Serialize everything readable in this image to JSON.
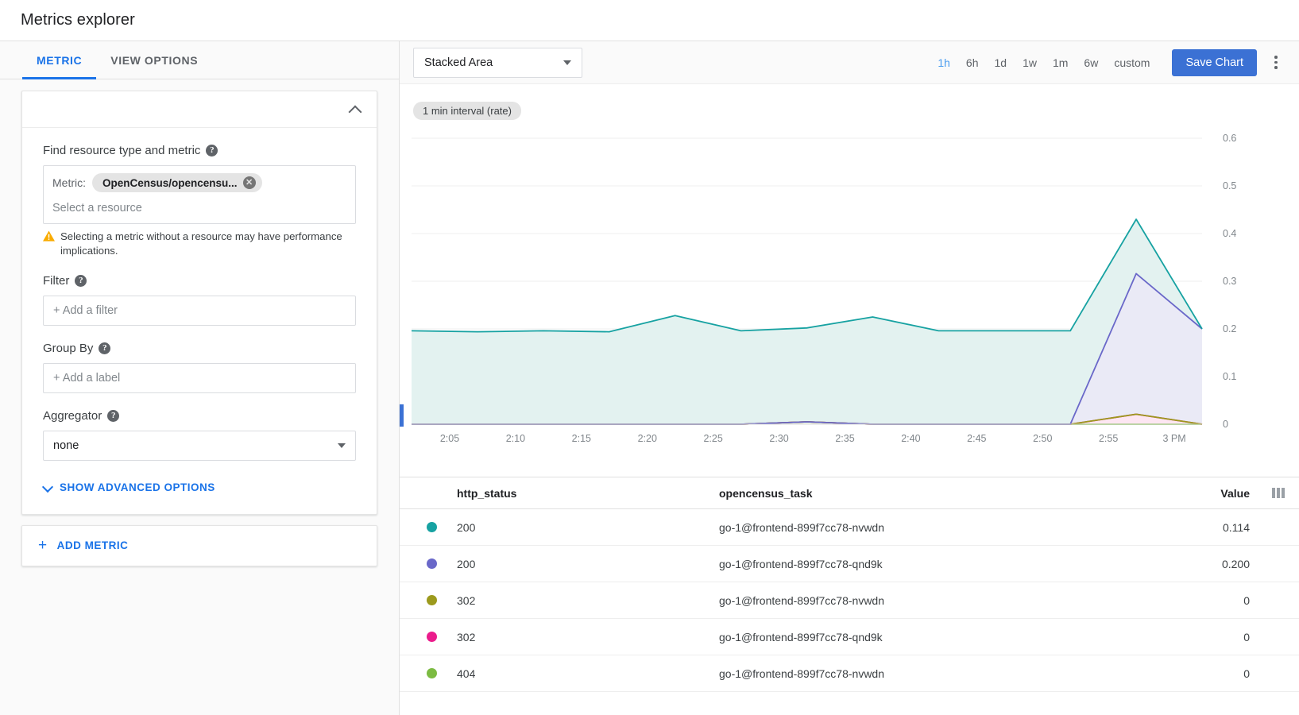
{
  "page": {
    "title": "Metrics explorer"
  },
  "left": {
    "tabs": [
      {
        "label": "METRIC",
        "active": true
      },
      {
        "label": "VIEW OPTIONS",
        "active": false
      }
    ],
    "find": {
      "label": "Find resource type and metric",
      "help": "?",
      "metric_key": "Metric:",
      "metric_chip": "OpenCensus/opencensu...",
      "chip_close": "✕",
      "resource_placeholder": "Select a resource",
      "warning": "Selecting a metric without a resource may have performance implications."
    },
    "filter": {
      "label": "Filter",
      "help": "?",
      "placeholder": "+ Add a filter"
    },
    "group_by": {
      "label": "Group By",
      "help": "?",
      "placeholder": "+ Add a label"
    },
    "aggregator": {
      "label": "Aggregator",
      "help": "?",
      "value": "none"
    },
    "advanced_label": "SHOW ADVANCED OPTIONS",
    "add_metric_label": "ADD METRIC",
    "add_metric_plus": "+"
  },
  "toolbar": {
    "chart_type": "Stacked Area",
    "ranges": [
      {
        "label": "1h",
        "active": true
      },
      {
        "label": "6h",
        "active": false
      },
      {
        "label": "1d",
        "active": false
      },
      {
        "label": "1w",
        "active": false
      },
      {
        "label": "1m",
        "active": false
      },
      {
        "label": "6w",
        "active": false
      },
      {
        "label": "custom",
        "active": false
      }
    ],
    "save_label": "Save Chart"
  },
  "chart": {
    "interval_pill": "1 min interval (rate)"
  },
  "chart_data": {
    "type": "area",
    "title": "",
    "subtitle": "1 min interval (rate)",
    "stacked": true,
    "xlabel": "",
    "ylabel": "",
    "ylim": [
      0,
      0.6
    ],
    "yticks": [
      "0",
      "0.1",
      "0.2",
      "0.3",
      "0.4",
      "0.5",
      "0.6"
    ],
    "ytick_values": [
      0,
      0.1,
      0.2,
      0.3,
      0.4,
      0.5,
      0.6
    ],
    "xticks": [
      "2:05",
      "2:10",
      "2:15",
      "2:20",
      "2:25",
      "2:30",
      "2:35",
      "2:40",
      "2:45",
      "2:50",
      "2:55",
      "3 PM"
    ],
    "grid": true,
    "legend_position": "table-below",
    "x": [
      2.0,
      2.05,
      2.1,
      2.15,
      2.2,
      2.25,
      2.3,
      2.35,
      2.4,
      2.45,
      2.5,
      2.55,
      3.0
    ],
    "series": [
      {
        "name": "200 go-1@frontend-899f7cc78-nvwdn",
        "color": "#17a2a2",
        "fill": "#e3f2f0",
        "http_status": "200",
        "task": "go-1@frontend-899f7cc78-nvwdn",
        "value": "0.114",
        "values": [
          0.196,
          0.194,
          0.196,
          0.194,
          0.228,
          0.196,
          0.197,
          0.225,
          0.196,
          0.196,
          0.196,
          0.114,
          0.0
        ]
      },
      {
        "name": "200 go-1@frontend-899f7cc78-qnd9k",
        "color": "#6a68c9",
        "fill": "#eaeaf6",
        "http_status": "200",
        "task": "go-1@frontend-899f7cc78-qnd9k",
        "value": "0.200",
        "values": [
          0.0,
          0.0,
          0.0,
          0.0,
          0.0,
          0.0,
          0.0,
          0.0,
          0.0,
          0.0,
          0.0,
          0.295,
          0.2
        ]
      },
      {
        "name": "302 go-1@frontend-899f7cc78-nvwdn",
        "color": "#9c9a1d",
        "fill": "#f5f3d8",
        "http_status": "302",
        "task": "go-1@frontend-899f7cc78-nvwdn",
        "value": "0",
        "values": [
          0,
          0,
          0,
          0,
          0,
          0,
          0,
          0,
          0,
          0,
          0,
          0,
          0
        ]
      },
      {
        "name": "302 go-1@frontend-899f7cc78-qnd9k",
        "color": "#eb1c8c",
        "fill": "#fde6f2",
        "http_status": "302",
        "task": "go-1@frontend-899f7cc78-qnd9k",
        "value": "0",
        "values": [
          0,
          0,
          0,
          0,
          0,
          0,
          0,
          0,
          0,
          0,
          0,
          0.021,
          0
        ]
      },
      {
        "name": "404 go-1@frontend-899f7cc78-nvwdn",
        "color": "#7cbb42",
        "fill": "#edf6e3",
        "http_status": "404",
        "task": "go-1@frontend-899f7cc78-nvwdn",
        "value": "0",
        "values": [
          0,
          0,
          0,
          0,
          0,
          0,
          0.005,
          0,
          0,
          0,
          0,
          0,
          0
        ]
      }
    ]
  },
  "table": {
    "columns": {
      "status": "http_status",
      "task": "opencensus_task",
      "value": "Value"
    },
    "rows": [
      {
        "color": "#17a2a2",
        "status": "200",
        "task": "go-1@frontend-899f7cc78-nvwdn",
        "value": "0.114"
      },
      {
        "color": "#6a68c9",
        "status": "200",
        "task": "go-1@frontend-899f7cc78-qnd9k",
        "value": "0.200"
      },
      {
        "color": "#9c9a1d",
        "status": "302",
        "task": "go-1@frontend-899f7cc78-nvwdn",
        "value": "0"
      },
      {
        "color": "#eb1c8c",
        "status": "302",
        "task": "go-1@frontend-899f7cc78-qnd9k",
        "value": "0"
      },
      {
        "color": "#7cbb42",
        "status": "404",
        "task": "go-1@frontend-899f7cc78-nvwdn",
        "value": "0"
      }
    ]
  },
  "colors": {
    "accent": "#1a73e8",
    "save_button": "#3b71d4",
    "warning": "#f9ab00"
  }
}
